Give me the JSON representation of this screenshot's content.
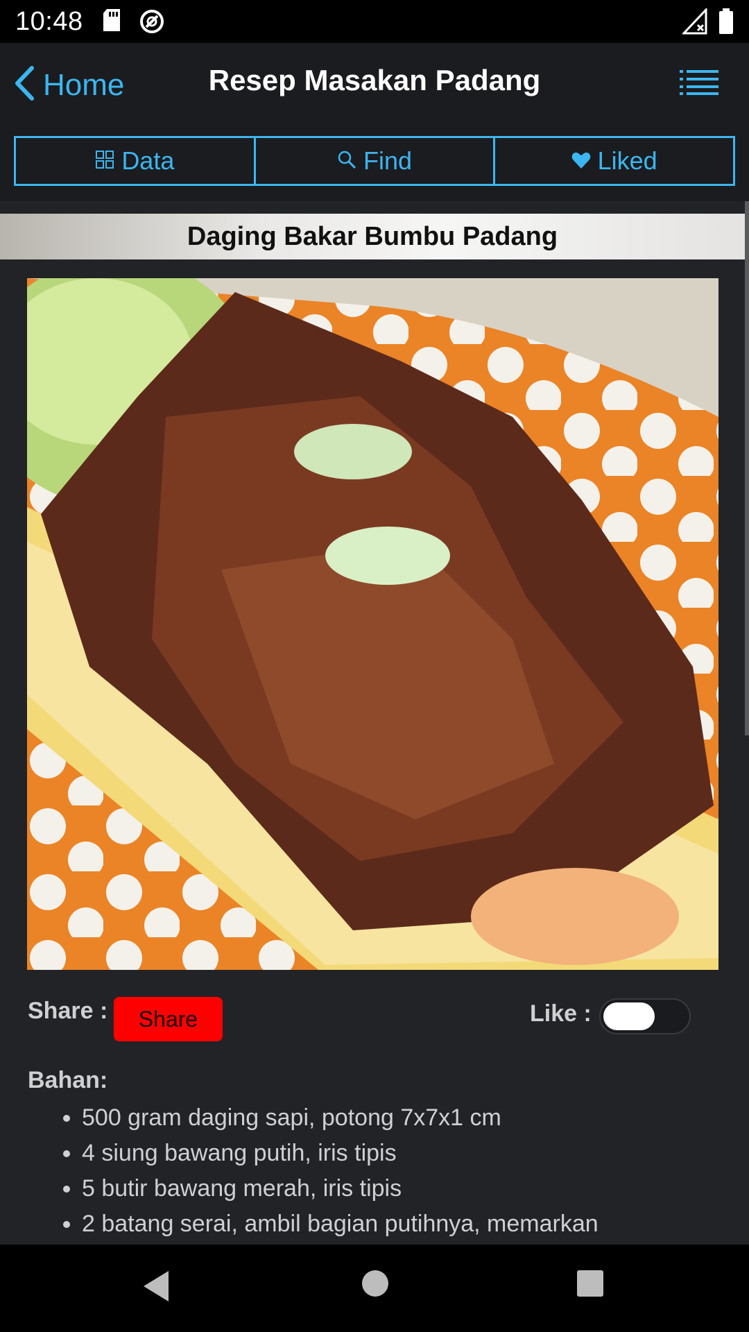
{
  "status_bar": {
    "time": "10:48"
  },
  "nav": {
    "back_label": "Home",
    "title": "Resep Masakan Padang"
  },
  "tabs": [
    {
      "label": "Data",
      "icon": "grid-icon"
    },
    {
      "label": "Find",
      "icon": "search-icon"
    },
    {
      "label": "Liked",
      "icon": "heart-icon"
    }
  ],
  "recipe": {
    "title": "Daging Bakar Bumbu Padang",
    "share_label": "Share :",
    "share_button": "Share",
    "like_label": "Like :",
    "liked": false,
    "ingredients_label": "Bahan:",
    "ingredients": [
      "500 gram daging sapi, potong 7x7x1 cm",
      "4 siung bawang putih, iris tipis",
      "5 butir bawang merah, iris tipis",
      "2 batang serai, ambil bagian putihnya, memarkan"
    ]
  },
  "colors": {
    "accent": "#3cb6f0",
    "share": "#ff0000",
    "background": "#222326",
    "bar": "#1b1c1f"
  }
}
